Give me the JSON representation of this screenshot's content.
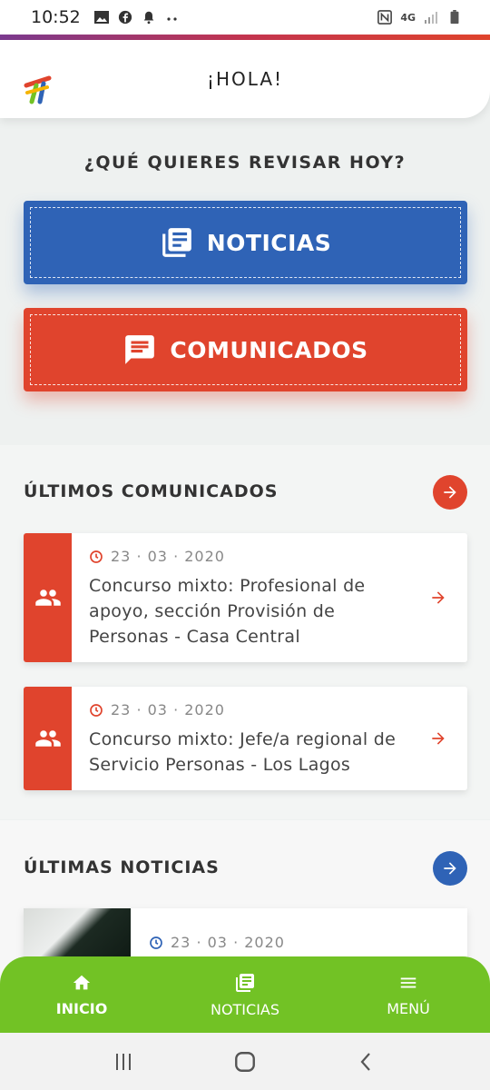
{
  "status_bar": {
    "time": "10:52",
    "left_icons": [
      "image-icon",
      "facebook-icon",
      "notification-bell-icon",
      "more-dots-icon"
    ],
    "right_icons": [
      "nfc-icon",
      "4g-data-icon",
      "signal-icon",
      "battery-icon"
    ],
    "network": "4G"
  },
  "header": {
    "title": "¡HOLA!",
    "logo": "app-logo-icon"
  },
  "question": "¿QUÉ QUIERES REVISAR HOY?",
  "buttons": {
    "news_label": "NOTICIAS",
    "comm_label": "COMUNICADOS",
    "news_color": "#2f63b6",
    "comm_color": "#e0442d"
  },
  "comunicados": {
    "title": "ÚLTIMOS COMUNICADOS",
    "items": [
      {
        "date": "23 · 03 · 2020",
        "text": "Concurso mixto: Profesional de apoyo, sección Provisión de Personas - Casa Central",
        "icon": "people-icon"
      },
      {
        "date": "23 · 03 · 2020",
        "text": "Concurso mixto: Jefe/a regional de Servicio Personas - Los Lagos",
        "icon": "people-icon"
      }
    ]
  },
  "noticias": {
    "title": "ÚLTIMAS NOTICIAS",
    "items": [
      {
        "date": "23 · 03 · 2020"
      }
    ]
  },
  "bottom_nav": {
    "items": [
      {
        "label": "INICIO",
        "icon": "home-icon",
        "active": true
      },
      {
        "label": "NOTICIAS",
        "icon": "newspaper-icon",
        "active": false
      },
      {
        "label": "MENÚ",
        "icon": "menu-icon",
        "active": false
      }
    ],
    "color": "#72c225"
  },
  "android_nav": [
    "recent-apps-icon",
    "home-circle-icon",
    "back-icon"
  ]
}
